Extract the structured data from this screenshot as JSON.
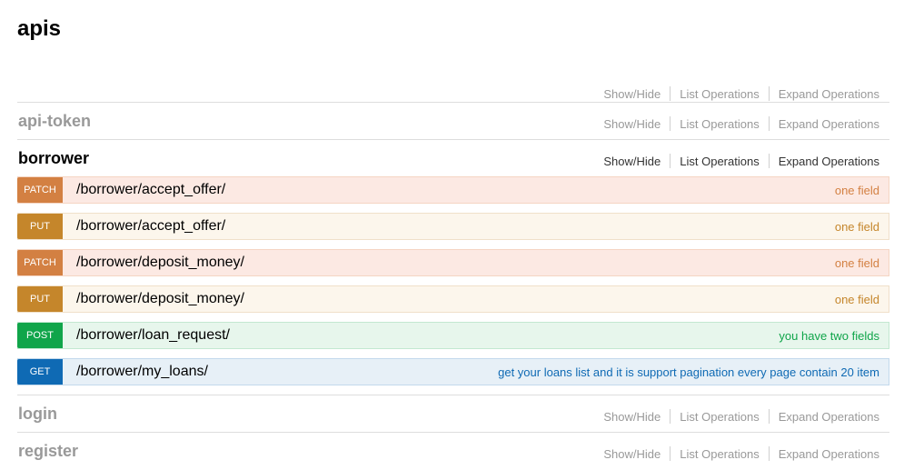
{
  "page": {
    "title": "apis"
  },
  "op_labels": {
    "show_hide": "Show/Hide",
    "list": "List Operations",
    "expand": "Expand Operations"
  },
  "resources": [
    {
      "name": "api-token"
    },
    {
      "name": "borrower"
    },
    {
      "name": "login"
    },
    {
      "name": "register"
    }
  ],
  "endpoints": [
    {
      "method": "PATCH",
      "path": "/borrower/accept_offer/",
      "summary": "one field"
    },
    {
      "method": "PUT",
      "path": "/borrower/accept_offer/",
      "summary": "one field"
    },
    {
      "method": "PATCH",
      "path": "/borrower/deposit_money/",
      "summary": "one field"
    },
    {
      "method": "PUT",
      "path": "/borrower/deposit_money/",
      "summary": "one field"
    },
    {
      "method": "POST",
      "path": "/borrower/loan_request/",
      "summary": "you have two fields"
    },
    {
      "method": "GET",
      "path": "/borrower/my_loans/",
      "summary": "get your loans list and it is support pagination every page contain 20 item"
    }
  ]
}
